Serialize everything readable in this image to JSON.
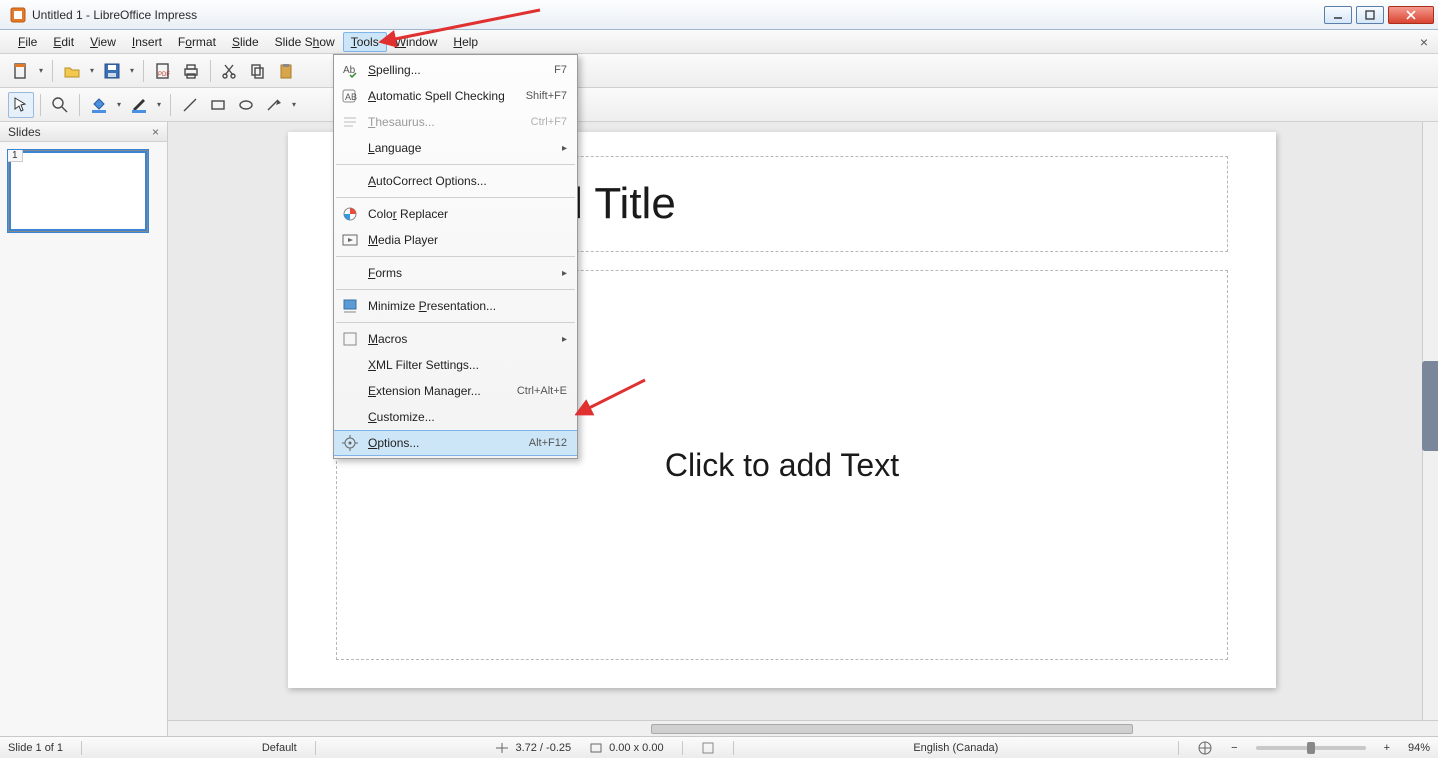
{
  "window": {
    "title": "Untitled 1 - LibreOffice Impress"
  },
  "menubar": {
    "items": [
      {
        "label": "File",
        "accel": "F"
      },
      {
        "label": "Edit",
        "accel": "E"
      },
      {
        "label": "View",
        "accel": "V"
      },
      {
        "label": "Insert",
        "accel": "I"
      },
      {
        "label": "Format",
        "accel": "o"
      },
      {
        "label": "Slide",
        "accel": "S"
      },
      {
        "label": "Slide Show",
        "accel": "h"
      },
      {
        "label": "Tools",
        "accel": "T",
        "active": true
      },
      {
        "label": "Window",
        "accel": "W"
      },
      {
        "label": "Help",
        "accel": "H"
      }
    ]
  },
  "tools_menu": {
    "items": [
      {
        "label": "Spelling...",
        "accel": "S",
        "shortcut": "F7",
        "icon": "spellcheck-icon"
      },
      {
        "label": "Automatic Spell Checking",
        "accel": "A",
        "shortcut": "Shift+F7",
        "icon": "auto-spellcheck-icon"
      },
      {
        "label": "Thesaurus...",
        "accel": "T",
        "shortcut": "Ctrl+F7",
        "icon": "thesaurus-icon",
        "disabled": true
      },
      {
        "label": "Language",
        "accel": "L",
        "submenu": true
      },
      {
        "sep": true
      },
      {
        "label": "AutoCorrect Options...",
        "accel": "A"
      },
      {
        "sep": true
      },
      {
        "label": "Color Replacer",
        "accel": "R",
        "icon": "color-replacer-icon"
      },
      {
        "label": "Media Player",
        "accel": "M",
        "icon": "media-player-icon"
      },
      {
        "sep": true
      },
      {
        "label": "Forms",
        "accel": "F",
        "submenu": true
      },
      {
        "sep": true
      },
      {
        "label": "Minimize Presentation...",
        "accel": "P",
        "icon": "minimize-presentation-icon"
      },
      {
        "sep": true
      },
      {
        "label": "Macros",
        "accel": "M",
        "submenu": true,
        "icon": "macros-icon"
      },
      {
        "label": "XML Filter Settings...",
        "accel": "X"
      },
      {
        "label": "Extension Manager...",
        "accel": "E",
        "shortcut": "Ctrl+Alt+E"
      },
      {
        "label": "Customize...",
        "accel": "C"
      },
      {
        "label": "Options...",
        "accel": "O",
        "shortcut": "Alt+F12",
        "icon": "options-icon",
        "hover": true
      }
    ]
  },
  "slides_panel": {
    "title": "Slides",
    "thumb_number": "1"
  },
  "slide": {
    "title_placeholder": "Click to add Title",
    "text_placeholder": "Click to add Text"
  },
  "statusbar": {
    "slide_of": "Slide 1 of 1",
    "master": "Default",
    "cursor": "3.72 / -0.25",
    "size": "0.00 x 0.00",
    "language": "English (Canada)",
    "zoom": "94%"
  }
}
